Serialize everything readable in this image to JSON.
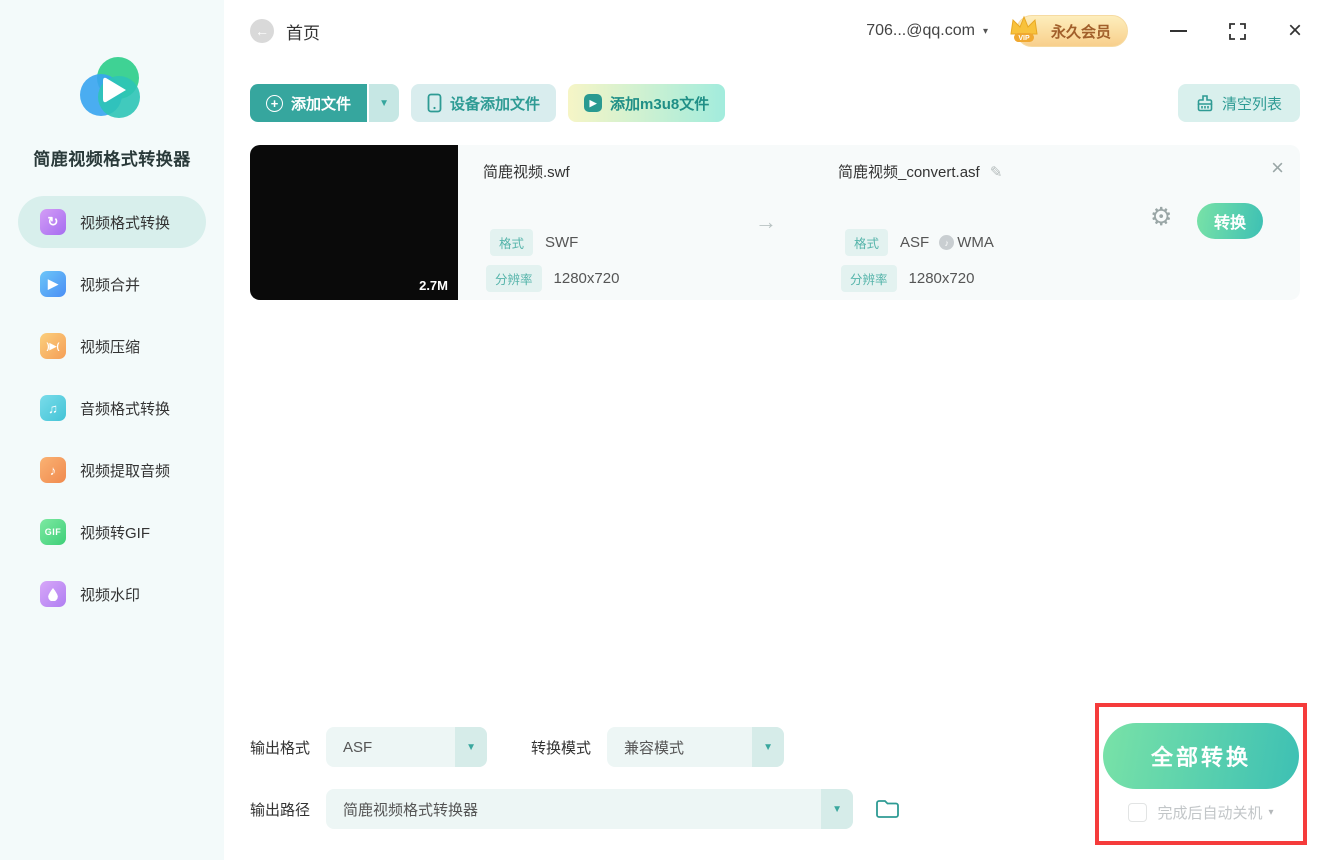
{
  "app": {
    "name": "简鹿视频格式转换器"
  },
  "titlebar": {
    "home_label": "首页",
    "account": "706...@qq.com",
    "vip_label": "永久会员"
  },
  "sidebar": {
    "items": [
      {
        "label": "视频格式转换",
        "active": true
      },
      {
        "label": "视频合并",
        "active": false
      },
      {
        "label": "视频压缩",
        "active": false
      },
      {
        "label": "音频格式转换",
        "active": false
      },
      {
        "label": "视频提取音频",
        "active": false
      },
      {
        "label": "视频转GIF",
        "active": false
      },
      {
        "label": "视频水印",
        "active": false
      }
    ]
  },
  "toolbar": {
    "add_file": "添加文件",
    "device_add": "设备添加文件",
    "add_m3u8": "添加m3u8文件",
    "clear_list": "清空列表"
  },
  "file_row": {
    "size": "2.7M",
    "source": {
      "name": "简鹿视频.swf",
      "format_label": "格式",
      "format": "SWF",
      "resolution_label": "分辨率",
      "resolution": "1280x720"
    },
    "target": {
      "name": "简鹿视频_convert.asf",
      "format_label": "格式",
      "format": "ASF",
      "audio_format": "WMA",
      "resolution_label": "分辨率",
      "resolution": "1280x720"
    },
    "convert_label": "转换"
  },
  "footer": {
    "output_format_label": "输出格式",
    "output_format_value": "ASF",
    "convert_mode_label": "转换模式",
    "convert_mode_value": "兼容模式",
    "output_path_label": "输出路径",
    "output_path_value": "简鹿视频格式转换器",
    "convert_all_label": "全部转换",
    "shutdown_label": "完成后自动关机"
  },
  "glyphs": {
    "back_arrow": "←",
    "plus": "+",
    "caret_down": "▼",
    "caret_small": "▾",
    "arrow_right": "→",
    "gear": "⚙",
    "pencil": "✎",
    "close": "×",
    "music_note": "♪",
    "refresh": "↻",
    "play": "▶",
    "compress": ")▶(",
    "note_double": "♫",
    "gif_text": "GIF"
  },
  "colors": {
    "teal_primary": "#36a69e",
    "sidebar_bg": "#f3fafa",
    "active_item_bg": "#d8efec",
    "green_gradient_start": "#79e2a7",
    "green_gradient_end": "#3dc0b4",
    "annotation_red": "#f53b3b",
    "vip_text": "#a15f2a",
    "chip_bg": "#e3f2f0",
    "chip_text": "#55b4aa"
  }
}
